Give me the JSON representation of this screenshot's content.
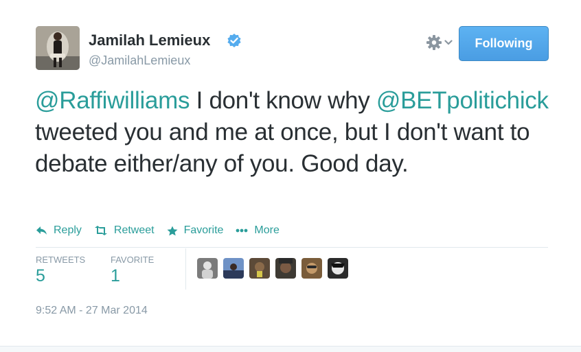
{
  "author": {
    "display_name": "Jamilah Lemieux",
    "screen_name": "@JamilahLemieux",
    "verified": true
  },
  "follow_button": {
    "label": "Following"
  },
  "tweet": {
    "mention_1": "@Raffiwilliams",
    "text_1": " I don't know why ",
    "mention_2": "@BETpolitichick",
    "text_2": " tweeted you and me at once, but I don't want to debate either/any of you. Good day."
  },
  "actions": {
    "reply": "Reply",
    "retweet": "Retweet",
    "favorite": "Favorite",
    "more": "More"
  },
  "stats": {
    "retweets_label": "RETWEETS",
    "retweets_count": "5",
    "favorites_label": "FAVORITE",
    "favorites_count": "1"
  },
  "timestamp": "9:52 AM - 27 Mar 2014",
  "colors": {
    "link": "#2a9d9a",
    "follow_button": "#4a9de3",
    "muted": "#8899a6",
    "verified": "#55acee"
  },
  "icons": {
    "settings": "gear-icon",
    "verified": "verified-badge-icon",
    "reply": "reply-icon",
    "retweet": "retweet-icon",
    "favorite": "star-icon",
    "more": "ellipsis-icon"
  }
}
